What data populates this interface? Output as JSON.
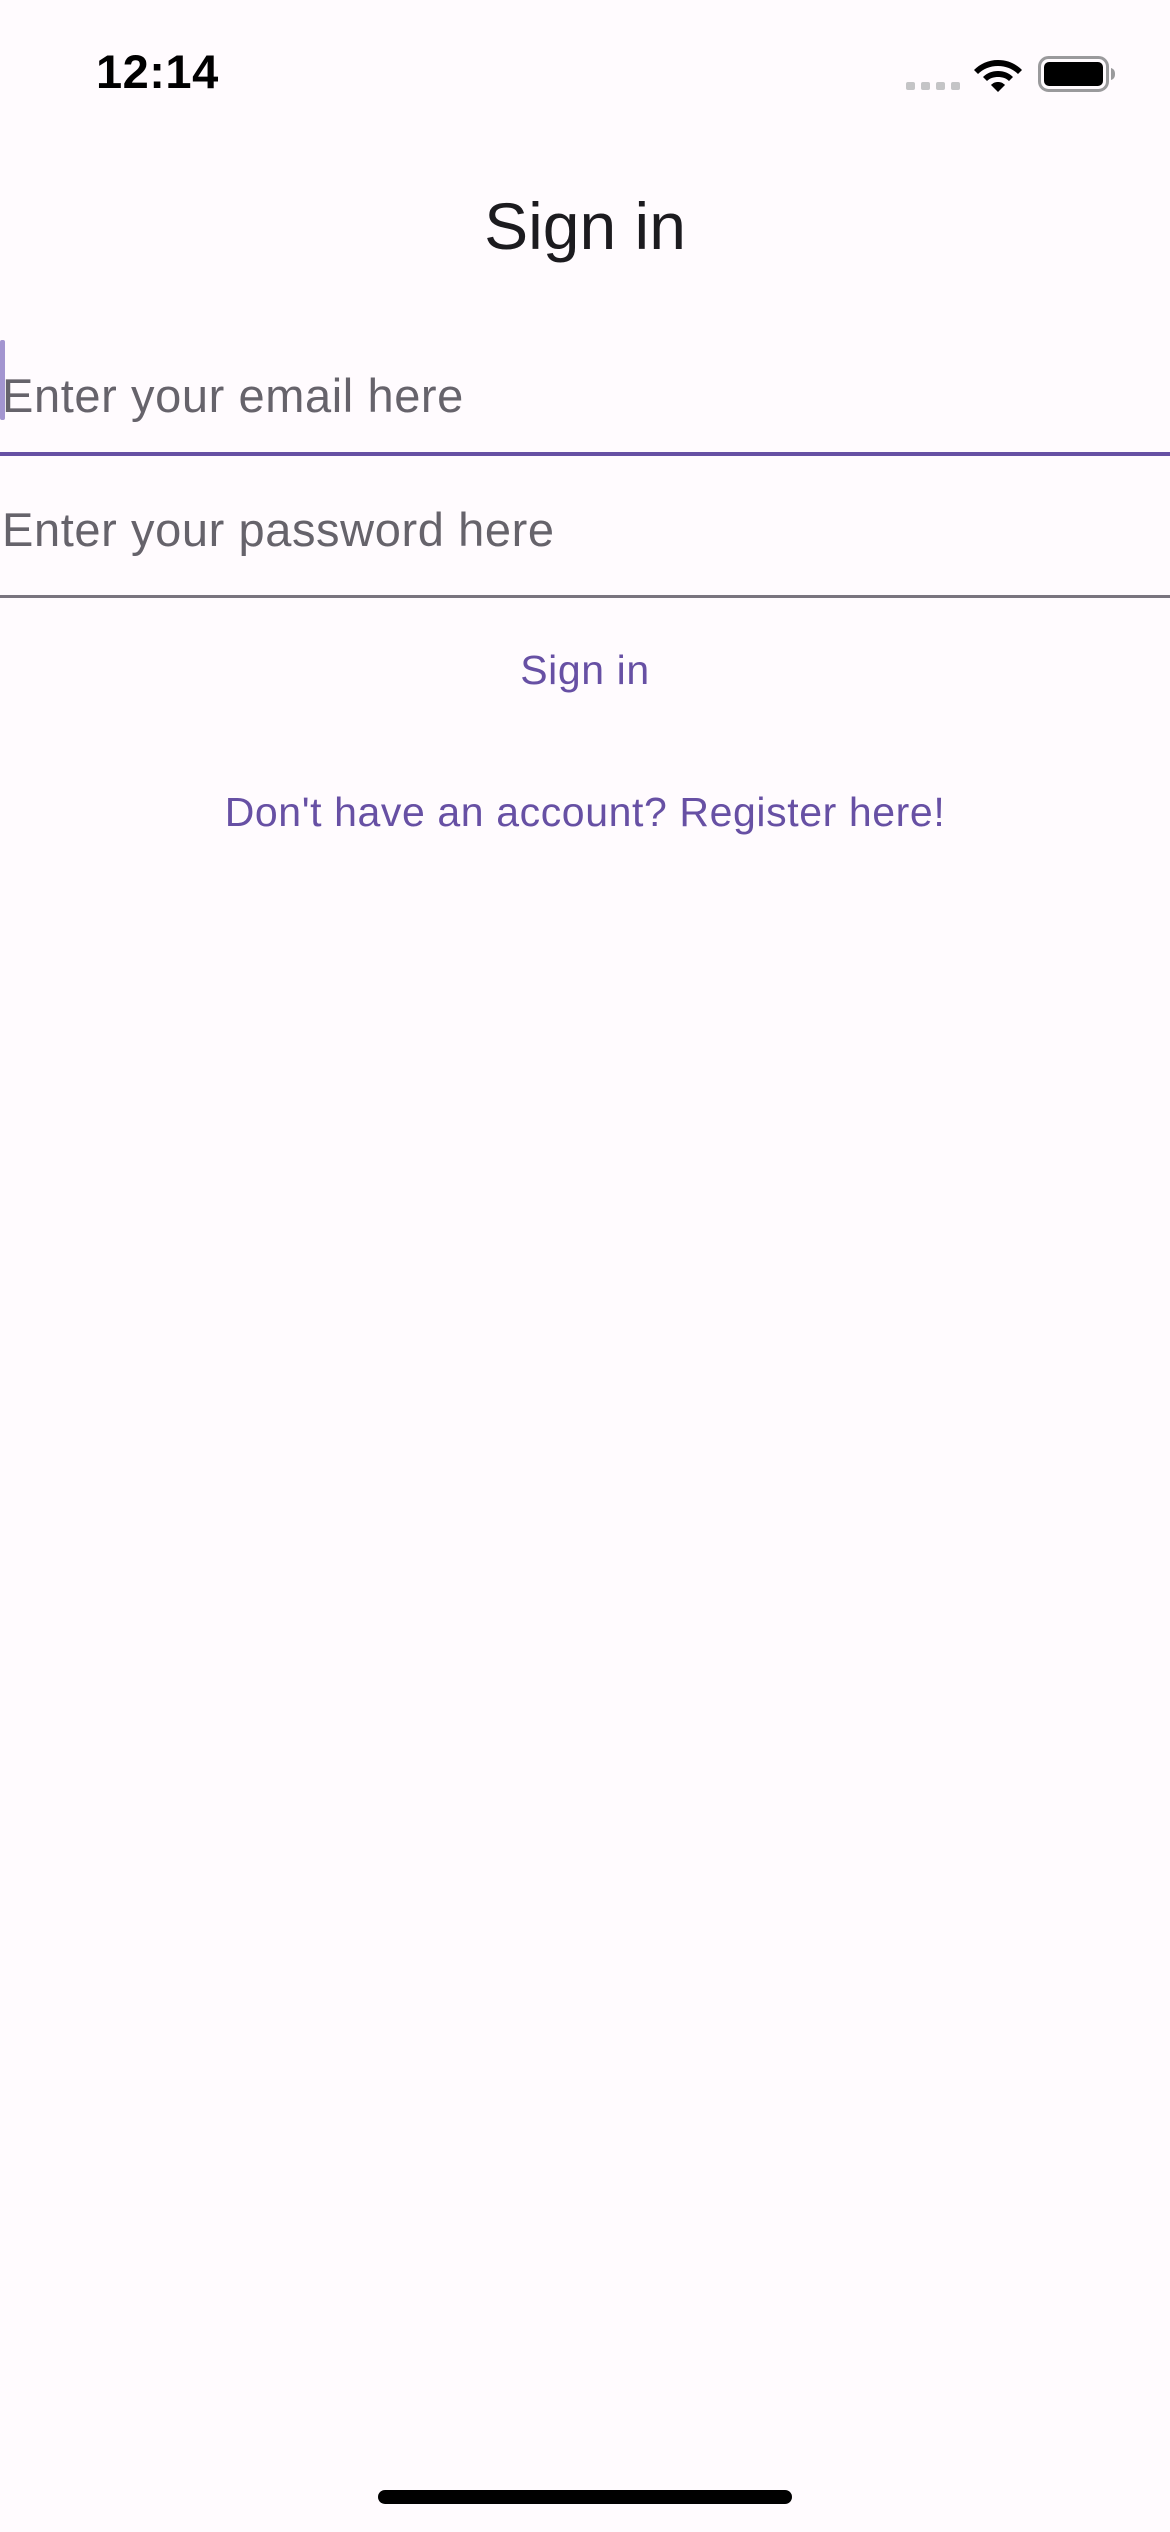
{
  "status_bar": {
    "time": "12:14",
    "signal_icon": "cellular-signal-icon",
    "wifi_icon": "wifi-icon",
    "battery_icon": "battery-icon"
  },
  "page": {
    "title": "Sign in"
  },
  "form": {
    "email": {
      "value": "",
      "placeholder": "Enter your email here"
    },
    "password": {
      "value": "",
      "placeholder": "Enter your password here"
    },
    "signin_label": "Sign in",
    "register_label": "Don't have an account? Register here!"
  },
  "colors": {
    "background": "#fffbfe",
    "accent": "#6750a4",
    "text": "#1c1b1f",
    "placeholder": "#66636b",
    "underline": "#79747e"
  }
}
